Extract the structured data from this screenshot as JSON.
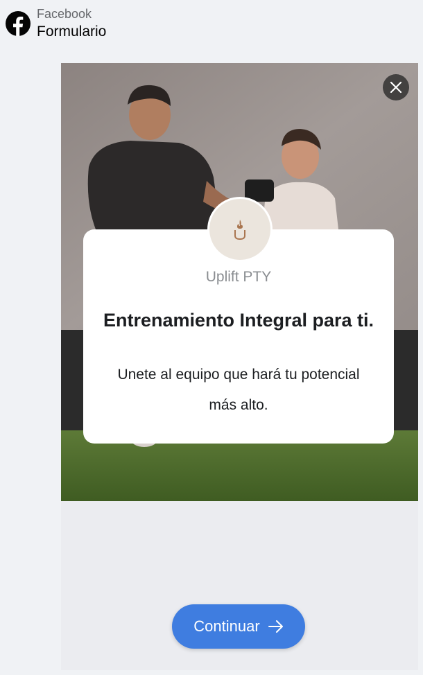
{
  "header": {
    "app_name": "Facebook",
    "title": "Formulario"
  },
  "icons": {
    "facebook": "facebook-logo-icon",
    "close": "close-icon",
    "brand_logo": "uplift-flame-logo-icon",
    "arrow": "arrow-right-icon"
  },
  "card": {
    "brand_name": "Uplift PTY",
    "headline": "Entrenamiento Integral para ti.",
    "description": "Unete al equipo que hará tu potencial más alto."
  },
  "footer": {
    "continue_label": "Continuar"
  },
  "colors": {
    "accent": "#3f7de0",
    "page_bg": "#f0f2f5",
    "panel_bg": "#ebecf0",
    "card_bg": "#ffffff",
    "logo_bg": "#ebe5dd"
  }
}
